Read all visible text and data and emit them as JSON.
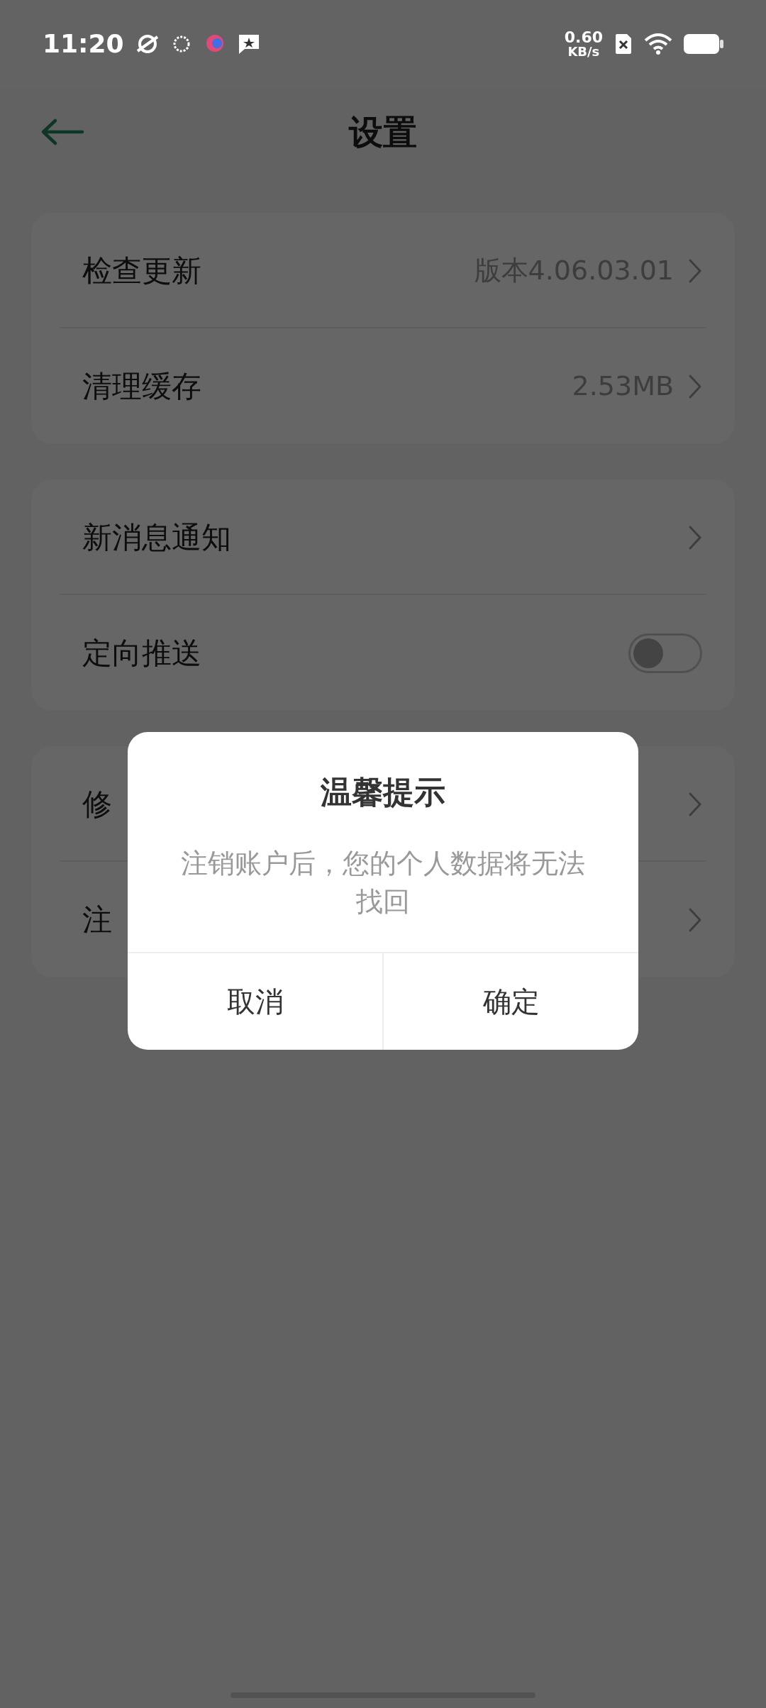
{
  "status_bar": {
    "time": "11:20",
    "speed": "0.60",
    "speed_unit": "KB/s"
  },
  "header": {
    "title": "设置"
  },
  "groups": [
    {
      "rows": [
        {
          "kind": "link",
          "label": "检查更新",
          "value": "版本4.06.03.01"
        },
        {
          "kind": "link",
          "label": "清理缓存",
          "value": "2.53MB"
        }
      ]
    },
    {
      "rows": [
        {
          "kind": "link",
          "label": "新消息通知"
        },
        {
          "kind": "toggle",
          "label": "定向推送",
          "on": false
        }
      ]
    },
    {
      "rows": [
        {
          "kind": "link",
          "label": "修"
        },
        {
          "kind": "link",
          "label": "注"
        }
      ]
    }
  ],
  "dialog": {
    "title": "温馨提示",
    "message": "注销账户后，您的个人数据将无法找回",
    "buttons": [
      "取消",
      "确定"
    ]
  }
}
